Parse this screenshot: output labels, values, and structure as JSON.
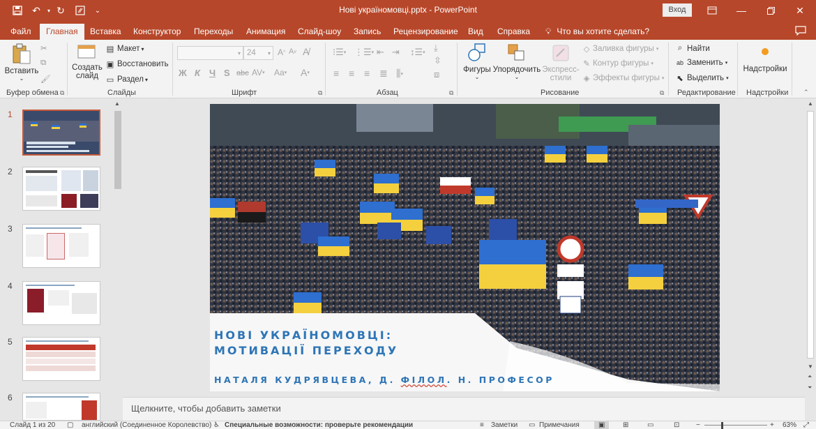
{
  "window": {
    "title": "Нові україномовці.pptx  -  PowerPoint",
    "signin_label": "Вход",
    "colors": {
      "brand": "#b7472a",
      "accent_text": "#2e75b6"
    }
  },
  "quick_access": [
    "save-icon",
    "undo-icon",
    "redo-icon",
    "touch-mode-icon",
    "customize-icon"
  ],
  "tabs": [
    {
      "label": "Файл"
    },
    {
      "label": "Главная"
    },
    {
      "label": "Вставка"
    },
    {
      "label": "Конструктор"
    },
    {
      "label": "Переходы"
    },
    {
      "label": "Анимация"
    },
    {
      "label": "Слайд-шоу"
    },
    {
      "label": "Запись"
    },
    {
      "label": "Рецензирование"
    },
    {
      "label": "Вид"
    },
    {
      "label": "Справка"
    }
  ],
  "tell_me": "Что вы хотите сделать?",
  "ribbon": {
    "clipboard": {
      "paste": "Вставить",
      "group": "Буфер обмена"
    },
    "slides": {
      "new_slide_1": "Создать",
      "new_slide_2": "слайд",
      "layout": "Макет",
      "reset": "Восстановить",
      "section": "Раздел",
      "group": "Слайды"
    },
    "font": {
      "font_size": "24",
      "group": "Шрифт"
    },
    "paragraph": {
      "group": "Абзац"
    },
    "drawing": {
      "shapes": "Фигуры",
      "arrange": "Упорядочить",
      "quick_styles_1": "Экспресс-",
      "quick_styles_2": "стили",
      "shape_fill": "Заливка фигуры",
      "shape_outline": "Контур фигуры",
      "shape_effects": "Эффекты фигуры",
      "group": "Рисование"
    },
    "editing": {
      "find": "Найти",
      "replace": "Заменить",
      "select": "Выделить",
      "group": "Редактирование"
    },
    "addins": {
      "label": "Надстройки",
      "group": "Надстройки"
    }
  },
  "thumbnails": [
    {
      "num": "1"
    },
    {
      "num": "2"
    },
    {
      "num": "3"
    },
    {
      "num": "4"
    },
    {
      "num": "5"
    },
    {
      "num": "6"
    }
  ],
  "slide": {
    "title_line1": "НОВІ УКРАЇНОМОВЦІ:",
    "title_line2": "МОТИВАЦІЇ ПЕРЕХОДУ",
    "author_before": "НАТАЛЯ КУДРЯВЦЕВА, Д. ",
    "author_underlined": "ФІЛОЛ",
    "author_after": ". Н. ПРОФЕСОР"
  },
  "notes_placeholder": "Щелкните, чтобы добавить заметки",
  "status": {
    "slide_count": "Слайд 1 из 20",
    "language": "английский (Соединенное Королевство)",
    "accessibility": "Специальные возможности: проверьте рекомендации",
    "notes": "Заметки",
    "comments": "Примечания",
    "zoom": "63%"
  }
}
